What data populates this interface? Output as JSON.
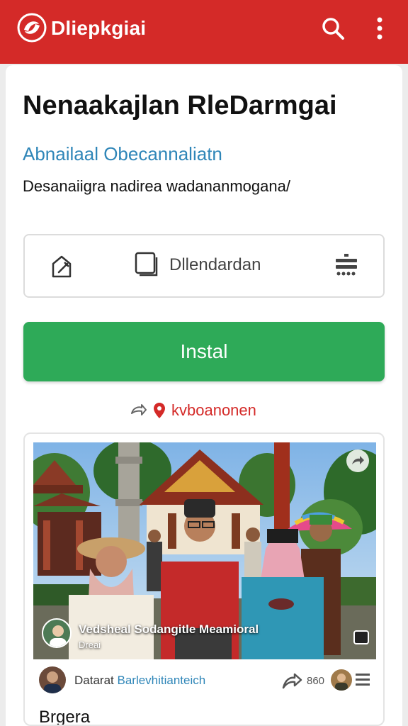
{
  "appbar": {
    "title": "Dliepkgiai",
    "logo_icon": "red-circle-logo-icon",
    "search_icon": "search-icon",
    "more_icon": "more-vertical-icon",
    "color": "#d42a28"
  },
  "content": {
    "title": "Nenaakajlan RleDarmgai",
    "subtitle": "Abnailaal Obecannaliatn",
    "description": "Desanaiigra nadirea wadananmogana/"
  },
  "actions": {
    "edit_icon": "edit-icon",
    "calendar_icon": "calendar-icon",
    "calendar_label": "Dllendardan",
    "filter_icon": "filter-icon"
  },
  "install": {
    "label": "Instal",
    "color": "#2eaa58"
  },
  "location": {
    "navigate_icon": "navigation-arrow-icon",
    "pin_icon": "location-pin-icon",
    "text": "kvboanonen"
  },
  "post": {
    "photo_icon": "festival-photo",
    "share_badge_icon": "share-icon",
    "caption_title": "Vedsheal Sodangitle Meamioral",
    "caption_sub": "Dreai",
    "author_name": "Datarat",
    "author_tag": "Barlevhitianteich",
    "share_count": "860",
    "menu_icon": "menu-icon"
  },
  "section": {
    "label": "Brgera"
  }
}
